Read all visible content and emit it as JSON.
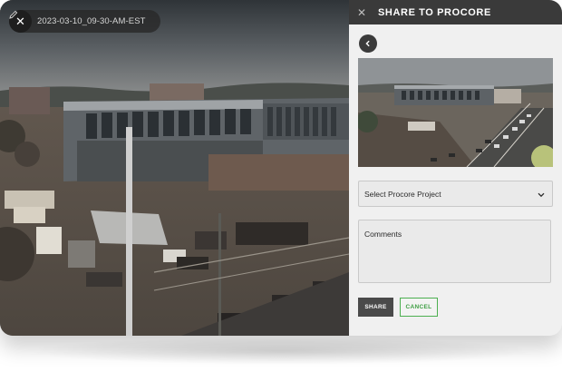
{
  "camera": {
    "snapshot_title": "2023-03-10_09-30-AM-EST",
    "close_icon": "close-icon",
    "edit_icon": "pencil-icon"
  },
  "panel": {
    "title": "SHARE TO PROCORE",
    "close_glyph": "✕",
    "back_icon": "chevron-left-icon",
    "project_select": {
      "label": "Select Procore Project",
      "icon": "chevron-down-icon"
    },
    "comments_placeholder": "Comments",
    "share_label": "SHARE",
    "cancel_label": "CANCEL"
  },
  "colors": {
    "header_bg": "#3a3a3a",
    "panel_bg": "#f0f0f0",
    "share_bg": "#4a4a4a",
    "cancel_accent": "#4caf50"
  }
}
